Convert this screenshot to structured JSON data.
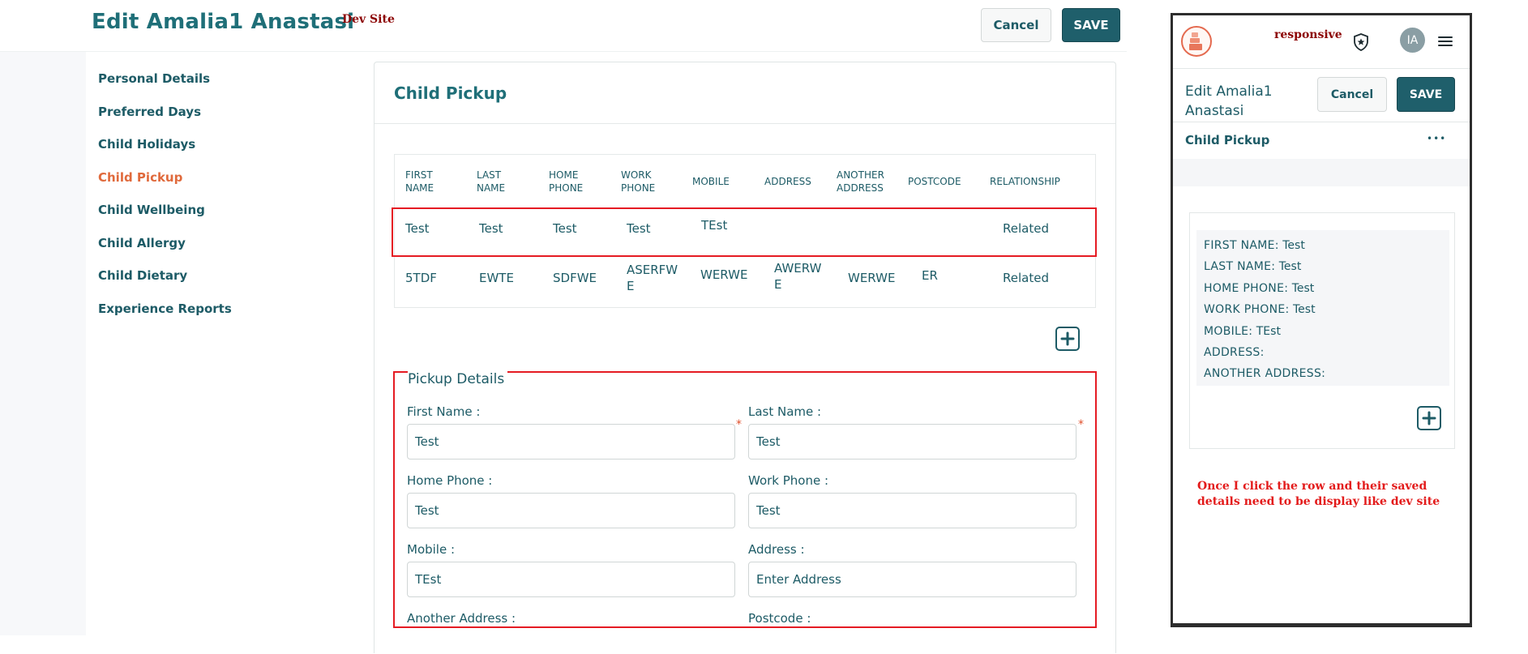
{
  "header": {
    "title": "Edit Amalia1 Anastasi",
    "dev_tag": "Dev Site",
    "cancel_label": "Cancel",
    "save_label": "SAVE"
  },
  "sidebar": {
    "items": [
      {
        "label": "Personal Details"
      },
      {
        "label": "Preferred Days"
      },
      {
        "label": "Child Holidays"
      },
      {
        "label": "Child Pickup",
        "active": true
      },
      {
        "label": "Child Wellbeing"
      },
      {
        "label": "Child Allergy"
      },
      {
        "label": "Child Dietary"
      },
      {
        "label": "Experience Reports"
      }
    ]
  },
  "section": {
    "title": "Child Pickup"
  },
  "table": {
    "headers": [
      [
        "FIRST",
        "NAME"
      ],
      [
        "LAST",
        "NAME"
      ],
      [
        "HOME",
        "PHONE"
      ],
      [
        "WORK",
        "PHONE"
      ],
      [
        "MOBILE"
      ],
      [
        "ADDRESS"
      ],
      [
        "ANOTHER",
        "ADDRESS"
      ],
      [
        "POSTCODE"
      ],
      [
        "RELATIONSHIP"
      ]
    ],
    "rows": [
      {
        "first": "Test",
        "last": "Test",
        "home": "Test",
        "work": "Test",
        "mobile": "TEst",
        "address": "",
        "another": "",
        "postcode": "",
        "relationship": "Related"
      },
      {
        "first": "5TDF",
        "last": "EWTE",
        "home": "SDFWE",
        "work_l1": "ASERFW",
        "work_l2": "E",
        "mobile": "WERWE",
        "address_l1": "AWERW",
        "address_l2": "E",
        "another": "WERWE",
        "postcode": "ER",
        "relationship": "Related"
      }
    ]
  },
  "form": {
    "legend": "Pickup Details",
    "first_name": {
      "label": "First Name :",
      "value": "Test"
    },
    "last_name": {
      "label": "Last Name :",
      "value": "Test"
    },
    "home_phone": {
      "label": "Home Phone :",
      "value": "Test"
    },
    "work_phone": {
      "label": "Work Phone :",
      "value": "Test"
    },
    "mobile": {
      "label": "Mobile :",
      "value": "TEst"
    },
    "address": {
      "label": "Address :",
      "value": "",
      "placeholder": "Enter Address"
    },
    "another_address": {
      "label": "Another Address :"
    },
    "postcode": {
      "label": "Postcode :"
    },
    "required_mark": "*"
  },
  "mobile_view": {
    "responsive_tag": "responsive",
    "avatar_initials": "IA",
    "title_line1": "Edit Amalia1",
    "title_line2": "Anastasi",
    "cancel_label": "Cancel",
    "save_label": "SAVE",
    "section_title": "Child Pickup",
    "more_icon": "•••",
    "details": [
      {
        "key": "FIRST NAME:",
        "value": "Test"
      },
      {
        "key": "LAST NAME:",
        "value": "Test"
      },
      {
        "key": "HOME PHONE:",
        "value": "Test"
      },
      {
        "key": "WORK PHONE:",
        "value": "Test"
      },
      {
        "key": "MOBILE:",
        "value": "TEst"
      },
      {
        "key": "ADDRESS:",
        "value": ""
      },
      {
        "key": "ANOTHER ADDRESS:",
        "value": ""
      }
    ]
  },
  "annotation": {
    "note": "Once I click the row and their saved details need to be display like dev site"
  },
  "colors": {
    "primary": "#1f5f6b",
    "active_nav": "#e06a3c",
    "highlight": "#e51b23",
    "dev_tag": "#8b0000"
  }
}
